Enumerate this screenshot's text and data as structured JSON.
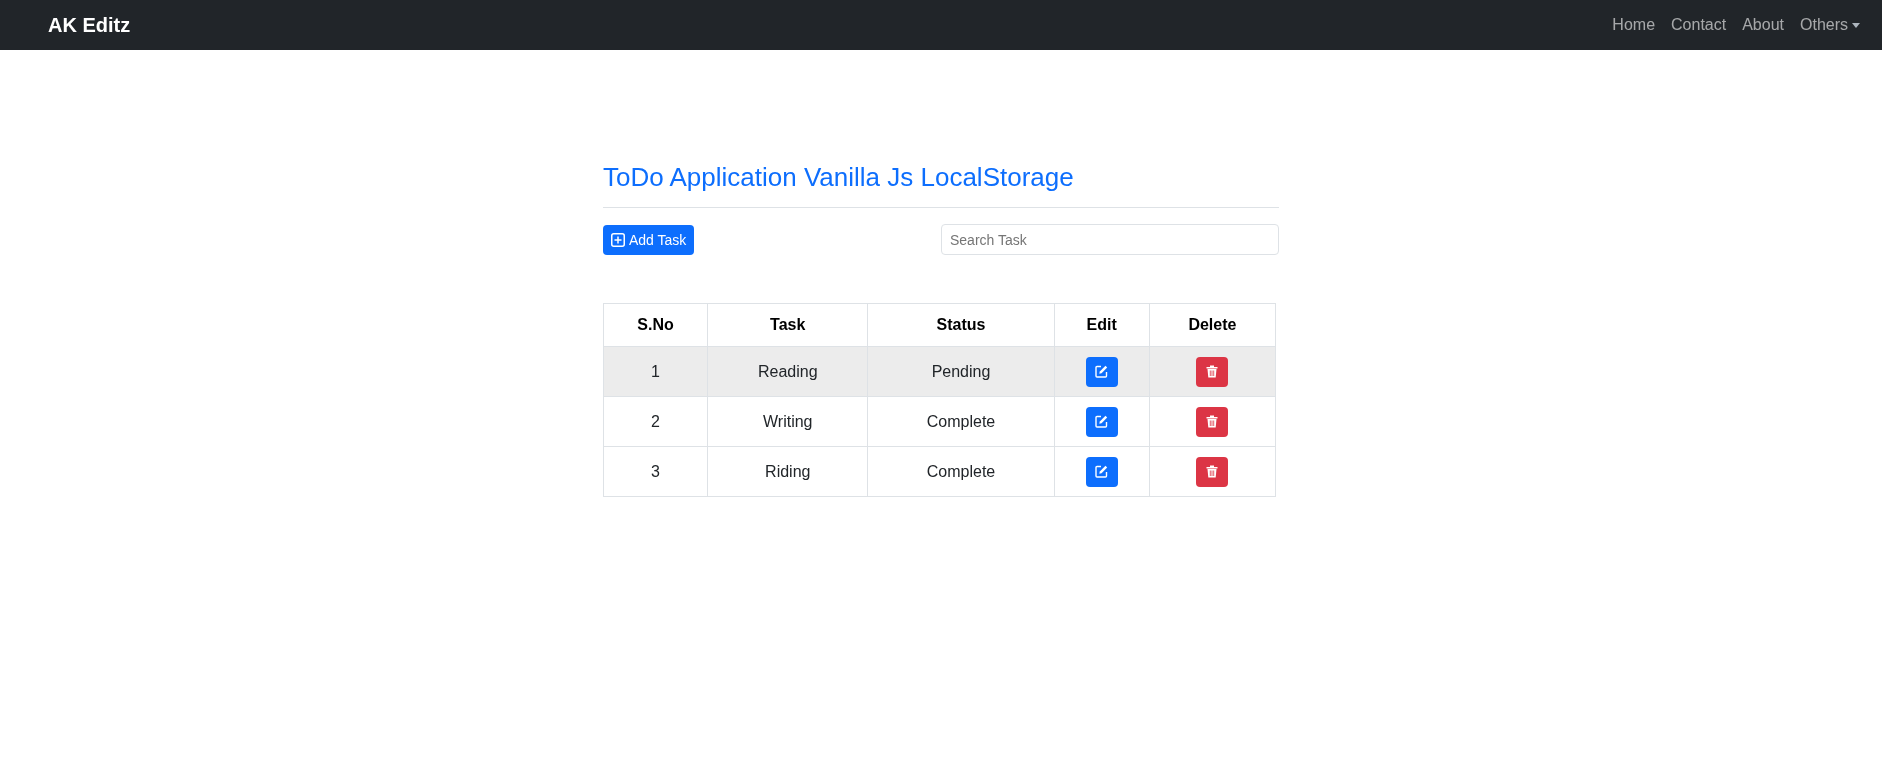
{
  "navbar": {
    "brand": "AK Editz",
    "links": [
      {
        "label": "Home",
        "kind": "link"
      },
      {
        "label": "Contact",
        "kind": "link"
      },
      {
        "label": "About",
        "kind": "link"
      },
      {
        "label": "Others",
        "kind": "dropdown"
      }
    ]
  },
  "title": "ToDo Application Vanilla Js LocalStorage",
  "add_button": "Add Task",
  "search": {
    "placeholder": "Search Task"
  },
  "table": {
    "columns": [
      "S.No",
      "Task",
      "Status",
      "Edit",
      "Delete"
    ],
    "rows": [
      {
        "sno": "1",
        "task": "Reading",
        "status": "Pending",
        "selected": true
      },
      {
        "sno": "2",
        "task": "Writing",
        "status": "Complete",
        "selected": false
      },
      {
        "sno": "3",
        "task": "Riding",
        "status": "Complete",
        "selected": false
      }
    ]
  }
}
